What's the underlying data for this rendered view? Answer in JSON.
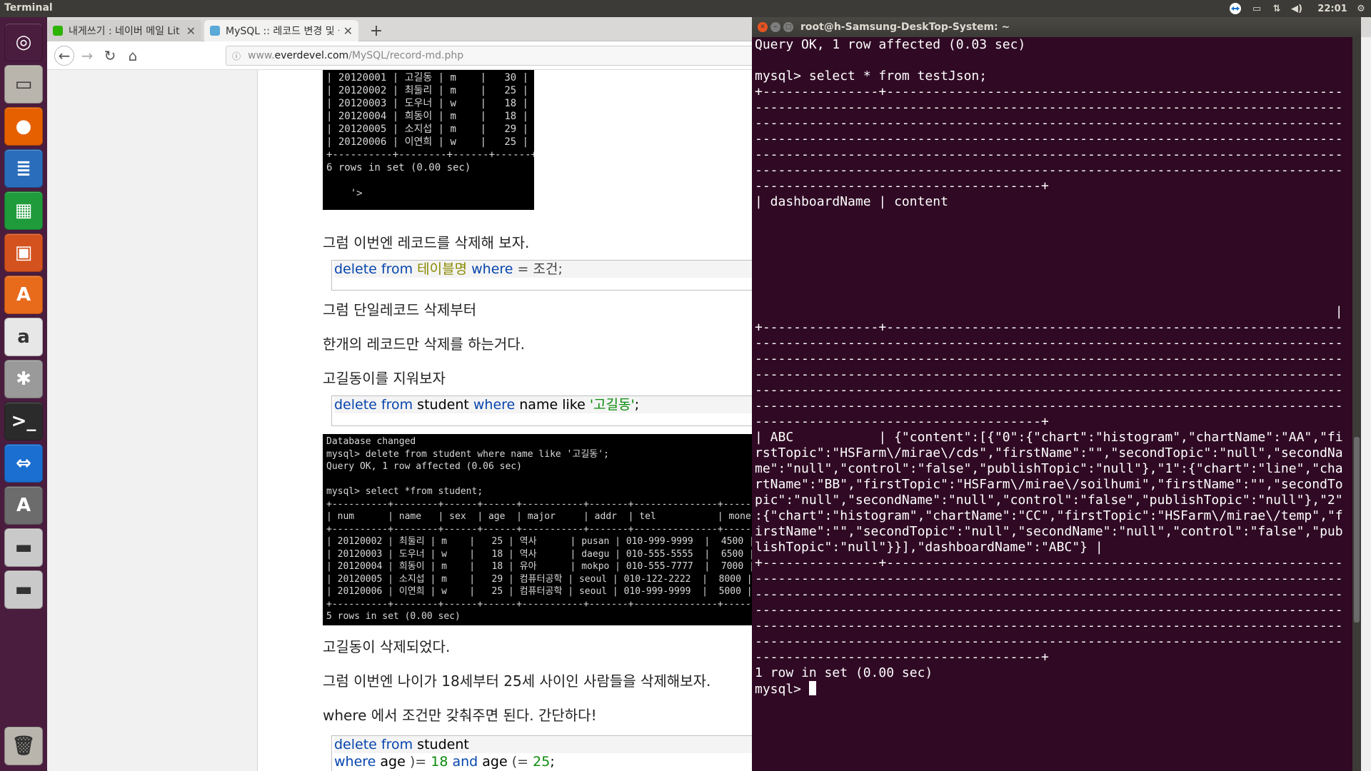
{
  "topbar": {
    "title": "Terminal",
    "clock": "22:01",
    "indicators": [
      "teamviewer-icon",
      "keyboard-icon",
      "network-icon",
      "volume-icon",
      "gear-icon"
    ]
  },
  "launcher": {
    "items": [
      {
        "name": "ubuntu-dash-icon",
        "glyph": "◎",
        "color": "#4a1d3f"
      },
      {
        "name": "files-icon",
        "glyph": "▭",
        "color": "#b9b4ac"
      },
      {
        "name": "firefox-icon",
        "glyph": "●",
        "color": "#e66000"
      },
      {
        "name": "writer-icon",
        "glyph": "≣",
        "color": "#2a6ebb"
      },
      {
        "name": "calc-icon",
        "glyph": "▦",
        "color": "#1f9b3b"
      },
      {
        "name": "impress-icon",
        "glyph": "▣",
        "color": "#d4521e"
      },
      {
        "name": "software-center-icon",
        "glyph": "A",
        "color": "#e86b1c"
      },
      {
        "name": "amazon-icon",
        "glyph": "a",
        "color": "#e7e7e7"
      },
      {
        "name": "settings-icon",
        "glyph": "✱",
        "color": "#9a9a9a"
      },
      {
        "name": "terminal-icon",
        "glyph": ">_",
        "color": "#2b2b2b"
      },
      {
        "name": "teamviewer-icon",
        "glyph": "⇔",
        "color": "#1a6fd0"
      },
      {
        "name": "software-updater-icon",
        "glyph": "A",
        "color": "#6c6c6c"
      },
      {
        "name": "drive-icon",
        "glyph": "▬",
        "color": "#c9c9c9"
      },
      {
        "name": "drive-icon",
        "glyph": "▬",
        "color": "#c9c9c9"
      }
    ],
    "trash": {
      "name": "trash-icon",
      "glyph": "🗑",
      "color": "#b9b4ac"
    }
  },
  "browser": {
    "tabs": [
      {
        "title": "내게쓰기 : 네이버 메일 Lit",
        "favicon_color": "#2db400",
        "active": false
      },
      {
        "title": "MySQL :: 레코드 변경 및 삭",
        "favicon_color": "#5aa9d6",
        "active": true
      }
    ],
    "new_tab_label": "+",
    "url_prefix": "www.",
    "url_domain": "everdevel.com",
    "url_path": "/MySQL/record-md.php",
    "info_glyph": "ⓘ",
    "menu_glyph": "☰"
  },
  "article": {
    "term1": "| 20120001 | 고길동 | m    |   30 |\n| 20120002 | 최둘리 | m    |   25 |\n| 20120003 | 도우너 | w    |   18 |\n| 20120004 | 희동이 | m    |   18 |\n| 20120005 | 소지섭 | m    |   29 |\n| 20120006 | 이연희 | w    |   25 |\n+----------+--------+------+------+\n6 rows in set (0.00 sec)\n\n    '>",
    "p1": "그럼 이번엔 레코드를 삭제해 보자.",
    "code1": {
      "kw1": "delete from",
      "tbl": "테이블명",
      "kw2": "where",
      "rest": "= 조건;"
    },
    "p2": "그럼 단일레코드 삭제부터",
    "p3": "한개의 레코드만 삭제를 하는거다.",
    "p4": "고길동이를 지워보자",
    "code2": {
      "kw1": "delete from",
      "tbl": "student",
      "kw2": "where",
      "col": "name like",
      "str": "'고길동'",
      "end": ";"
    },
    "term2": "Database changed\nmysql> delete from student where name like '고길동';\nQuery OK, 1 row affected (0.06 sec)\n\nmysql> select *from student;\n+----------+--------+------+------+-----------+-------+---------------+-------+\n| num      | name   | sex  | age  | major     | addr  | tel           | money |\n+----------+--------+------+------+-----------+-------+---------------+-------+\n| 20120002 | 최둘리 | m    |   25 | 역사      | pusan | 010-999-9999  |  4500 |\n| 20120003 | 도우너 | w    |   18 | 역사      | daegu | 010-555-5555  |  6500 |\n| 20120004 | 희동이 | m    |   18 | 유아      | mokpo | 010-555-7777  |  7000 |\n| 20120005 | 소지섭 | m    |   29 | 컴퓨터공학 | seoul | 010-122-2222  |  8000 |\n| 20120006 | 이연희 | w    |   25 | 컴퓨터공학 | seoul | 010-999-9999  |  5000 |\n+----------+--------+------+------+-----------+-------+---------------+-------+\n5 rows in set (0.00 sec)",
    "p5": "고길동이 삭제되었다.",
    "p6": "그럼 이번엔 나이가 18세부터 25세 사이인 사람들을 삭제해보자.",
    "p7": "where 에서 조건만 갖춰주면 된다. 간단하다!",
    "code3": {
      "line1_kw": "delete from",
      "line1_tbl": "student",
      "line2_kw1": "where",
      "line2_a": "age",
      "line2_op1": ")=",
      "line2_n1": "18",
      "line2_and": "and",
      "line2_b": "age",
      "line2_op2": "(=",
      "line2_n2": "25",
      "line2_end": ";"
    }
  },
  "terminal": {
    "title": "root@h-Samsung-DeskTop-System: ~",
    "buttons": [
      {
        "name": "close-button",
        "glyph": "✕",
        "color": "#e95420"
      },
      {
        "name": "minimize-button",
        "glyph": "–",
        "color": "#7d7d7d"
      },
      {
        "name": "maximize-button",
        "glyph": "□",
        "color": "#7d7d7d"
      }
    ],
    "output": "Query OK, 1 row affected (0.03 sec)\n\nmysql> select * from testJson;\n+---------------+-----------------------------------------------------------\n----------------------------------------------------------------------------\n----------------------------------------------------------------------------\n----------------------------------------------------------------------------\n----------------------------------------------------------------------------\n----------------------------------------------------------------------------\n-------------------------------------+\n| dashboardName | content\n\n\n\n\n\n\n                                                                           |\n+---------------+-----------------------------------------------------------\n----------------------------------------------------------------------------\n----------------------------------------------------------------------------\n----------------------------------------------------------------------------\n----------------------------------------------------------------------------\n----------------------------------------------------------------------------\n-------------------------------------+\n| ABC           | {\"content\":[{\"0\":{\"chart\":\"histogram\",\"chartName\":\"AA\",\"fi\nrstTopic\":\"HSFarm\\/mirae\\/cds\",\"firstName\":\"\",\"secondTopic\":\"null\",\"secondNa\nme\":\"null\",\"control\":\"false\",\"publishTopic\":\"null\"},\"1\":{\"chart\":\"line\",\"cha\nrtName\":\"BB\",\"firstTopic\":\"HSFarm\\/mirae\\/soilhumi\",\"firstName\":\"\",\"secondTo\npic\":\"null\",\"secondName\":\"null\",\"control\":\"false\",\"publishTopic\":\"null\"},\"2\"\n:{\"chart\":\"histogram\",\"chartName\":\"CC\",\"firstTopic\":\"HSFarm\\/mirae\\/temp\",\"f\nirstName\":\"\",\"secondTopic\":\"null\",\"secondName\":\"null\",\"control\":\"false\",\"pub\nlishTopic\":\"null\"}}],\"dashboardName\":\"ABC\"} |\n+---------------+-----------------------------------------------------------\n----------------------------------------------------------------------------\n----------------------------------------------------------------------------\n----------------------------------------------------------------------------\n----------------------------------------------------------------------------\n----------------------------------------------------------------------------\n-------------------------------------+\n1 row in set (0.00 sec)\n",
    "prompt": "mysql> "
  }
}
